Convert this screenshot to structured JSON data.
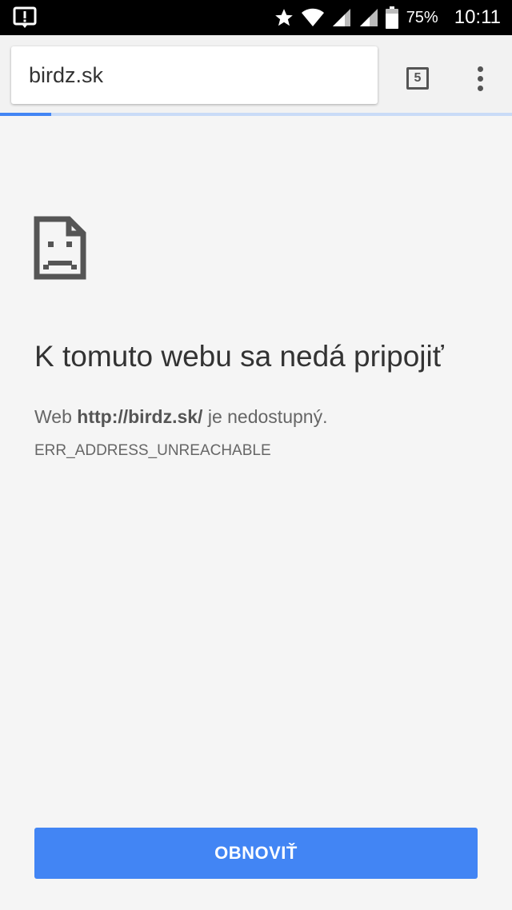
{
  "status_bar": {
    "icons": [
      "alert-icon",
      "star-icon",
      "wifi-icon",
      "signal-icon",
      "signal-2-icon",
      "battery-icon"
    ],
    "battery_percent": "75%",
    "time": "10:11"
  },
  "toolbar": {
    "url": "birdz.sk",
    "tab_count": "5",
    "menu_icon": "more-vert-icon"
  },
  "page_load": {
    "progress_fraction": 0.1
  },
  "error": {
    "icon": "sad-document-icon",
    "title": "K tomuto webu sa nedá pripojiť",
    "desc_prefix": "Web ",
    "desc_host": "http://birdz.sk/",
    "desc_suffix": " je nedostupný.",
    "code": "ERR_ADDRESS_UNREACHABLE",
    "reload_label": "OBNOVIŤ"
  },
  "colors": {
    "accent": "#4285f4",
    "progress_track": "#c9dbf7",
    "background": "#f5f5f5"
  }
}
